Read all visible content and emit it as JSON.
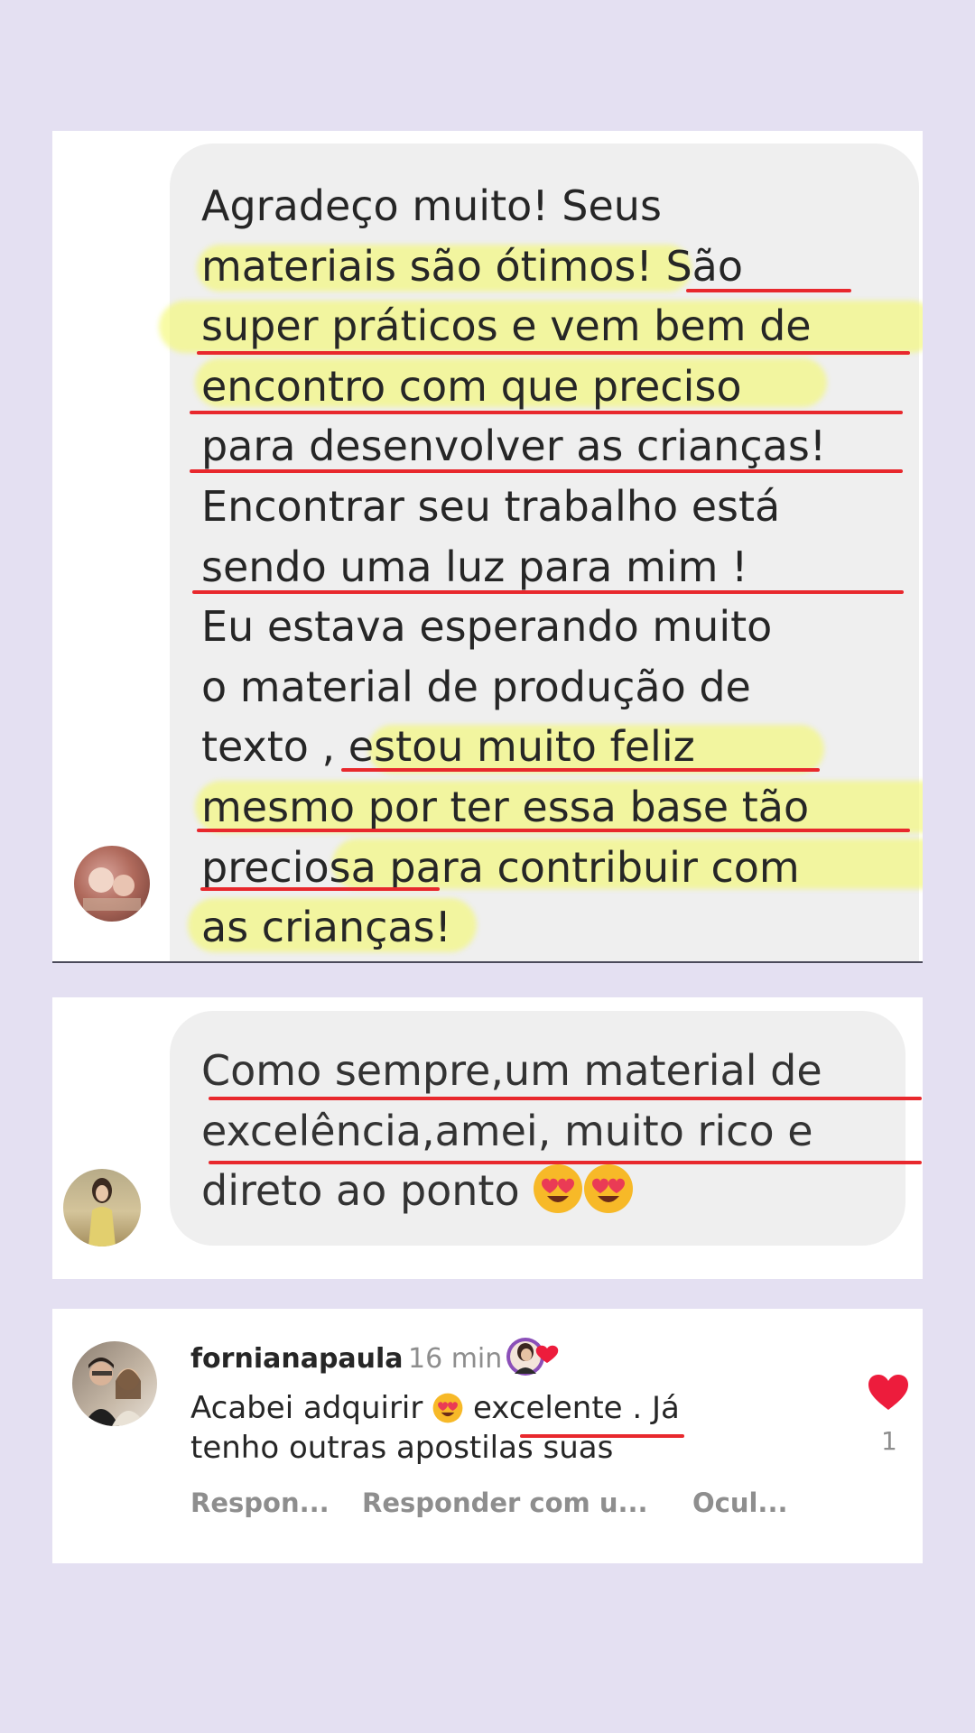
{
  "message1": {
    "lines": [
      "Agradeço muito! Seus",
      "materiais são ótimos! São",
      "super práticos e vem bem de",
      "encontro com que preciso",
      "para desenvolver as crianças!",
      "Encontrar seu trabalho está",
      "sendo uma luz para mim !",
      "Eu estava esperando muito",
      "o material de produção de",
      "texto , estou muito feliz",
      "mesmo  por ter essa base tão",
      "preciosa para contribuir com",
      "as crianças!"
    ]
  },
  "message2": {
    "lines": [
      "Como sempre,um material de",
      "excelência,amei, muito rico e",
      "direto ao ponto"
    ]
  },
  "comment": {
    "username": "fornianapaula",
    "time": "16 min",
    "text_before_emoji": "Acabei adquirir",
    "text_after_emoji": "excelente . Já",
    "text_line2": "tenho outras apostilas suas",
    "actions": [
      "Respon...",
      "Responder com u...",
      "Ocul..."
    ],
    "like_count": "1"
  },
  "colors": {
    "background": "#e4e0f2",
    "bubble": "#efefef",
    "highlight": "#f4f86e",
    "underline": "#e8282d",
    "like_heart": "#ed1c3c"
  },
  "icons": {
    "emoji": "heart-eyes-emoji",
    "like": "heart-icon",
    "creator_like": "creator-heart-badge"
  }
}
